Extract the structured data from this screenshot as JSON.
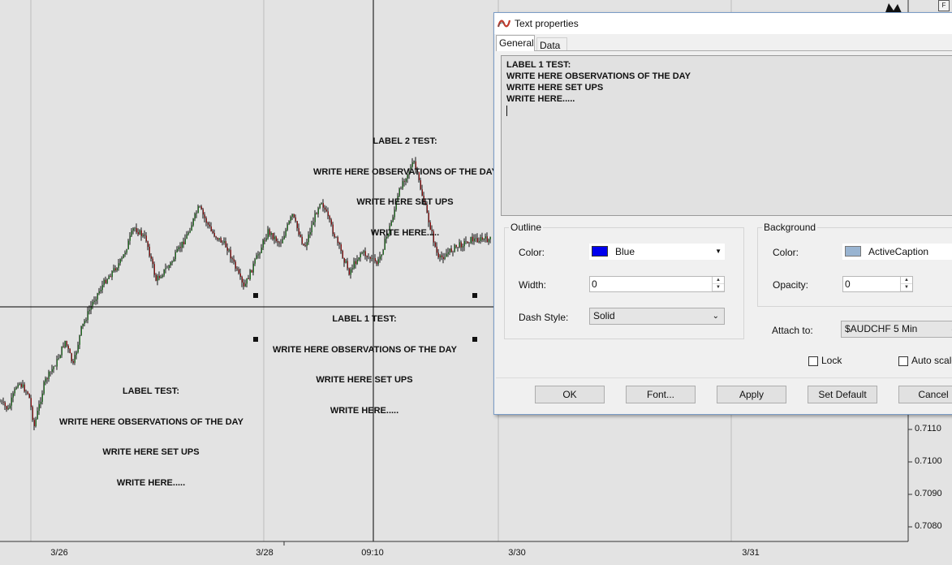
{
  "chart": {
    "symbol": "$AUDCHF 5 Min",
    "price_labels": [
      "0.7110",
      "0.7100",
      "0.7090",
      "0.7080"
    ],
    "date_labels": [
      "3/26",
      "3/28",
      "09:10",
      "3/30",
      "3/31"
    ],
    "corner_marker": "F",
    "text_objects": [
      {
        "lines": [
          "LABEL 2 TEST:",
          "WRITE HERE OBSERVATIONS OF THE DAY",
          "WRITE HERE SET UPS",
          "WRITE HERE....."
        ]
      },
      {
        "lines": [
          "LABEL 1 TEST:",
          "WRITE HERE OBSERVATIONS OF THE DAY",
          "WRITE HERE SET UPS",
          "WRITE HERE....."
        ]
      },
      {
        "lines": [
          "LABEL TEST:",
          "WRITE HERE OBSERVATIONS OF THE DAY",
          "WRITE HERE SET UPS",
          "WRITE HERE....."
        ]
      }
    ],
    "colors": {
      "background": "#e3e3e3",
      "up_bar": "#1f6e1f",
      "down_bar": "#8b1010",
      "crosshair": "#000000"
    }
  },
  "dialog": {
    "title": "Text properties",
    "tabs": [
      "General",
      "Data"
    ],
    "text_lines": [
      "LABEL 1 TEST:",
      "WRITE HERE OBSERVATIONS OF THE DAY",
      "WRITE HERE SET UPS",
      "WRITE HERE....."
    ],
    "outline": {
      "group_label": "Outline",
      "color_label": "Color:",
      "color_value": "Blue",
      "color_hex": "#0000ee",
      "width_label": "Width:",
      "width_value": "0",
      "dash_label": "Dash Style:",
      "dash_value": "Solid"
    },
    "background": {
      "group_label": "Background",
      "color_label": "Color:",
      "color_value": "ActiveCaption",
      "color_hex": "#99b4d1",
      "opacity_label": "Opacity:",
      "opacity_value": "0"
    },
    "attach_label": "Attach to:",
    "attach_value": "$AUDCHF 5 Min",
    "lock_label": "Lock",
    "autoscale_label": "Auto scale",
    "buttons": {
      "ok": "OK",
      "font": "Font...",
      "apply": "Apply",
      "set_default": "Set Default",
      "cancel": "Cancel"
    }
  }
}
